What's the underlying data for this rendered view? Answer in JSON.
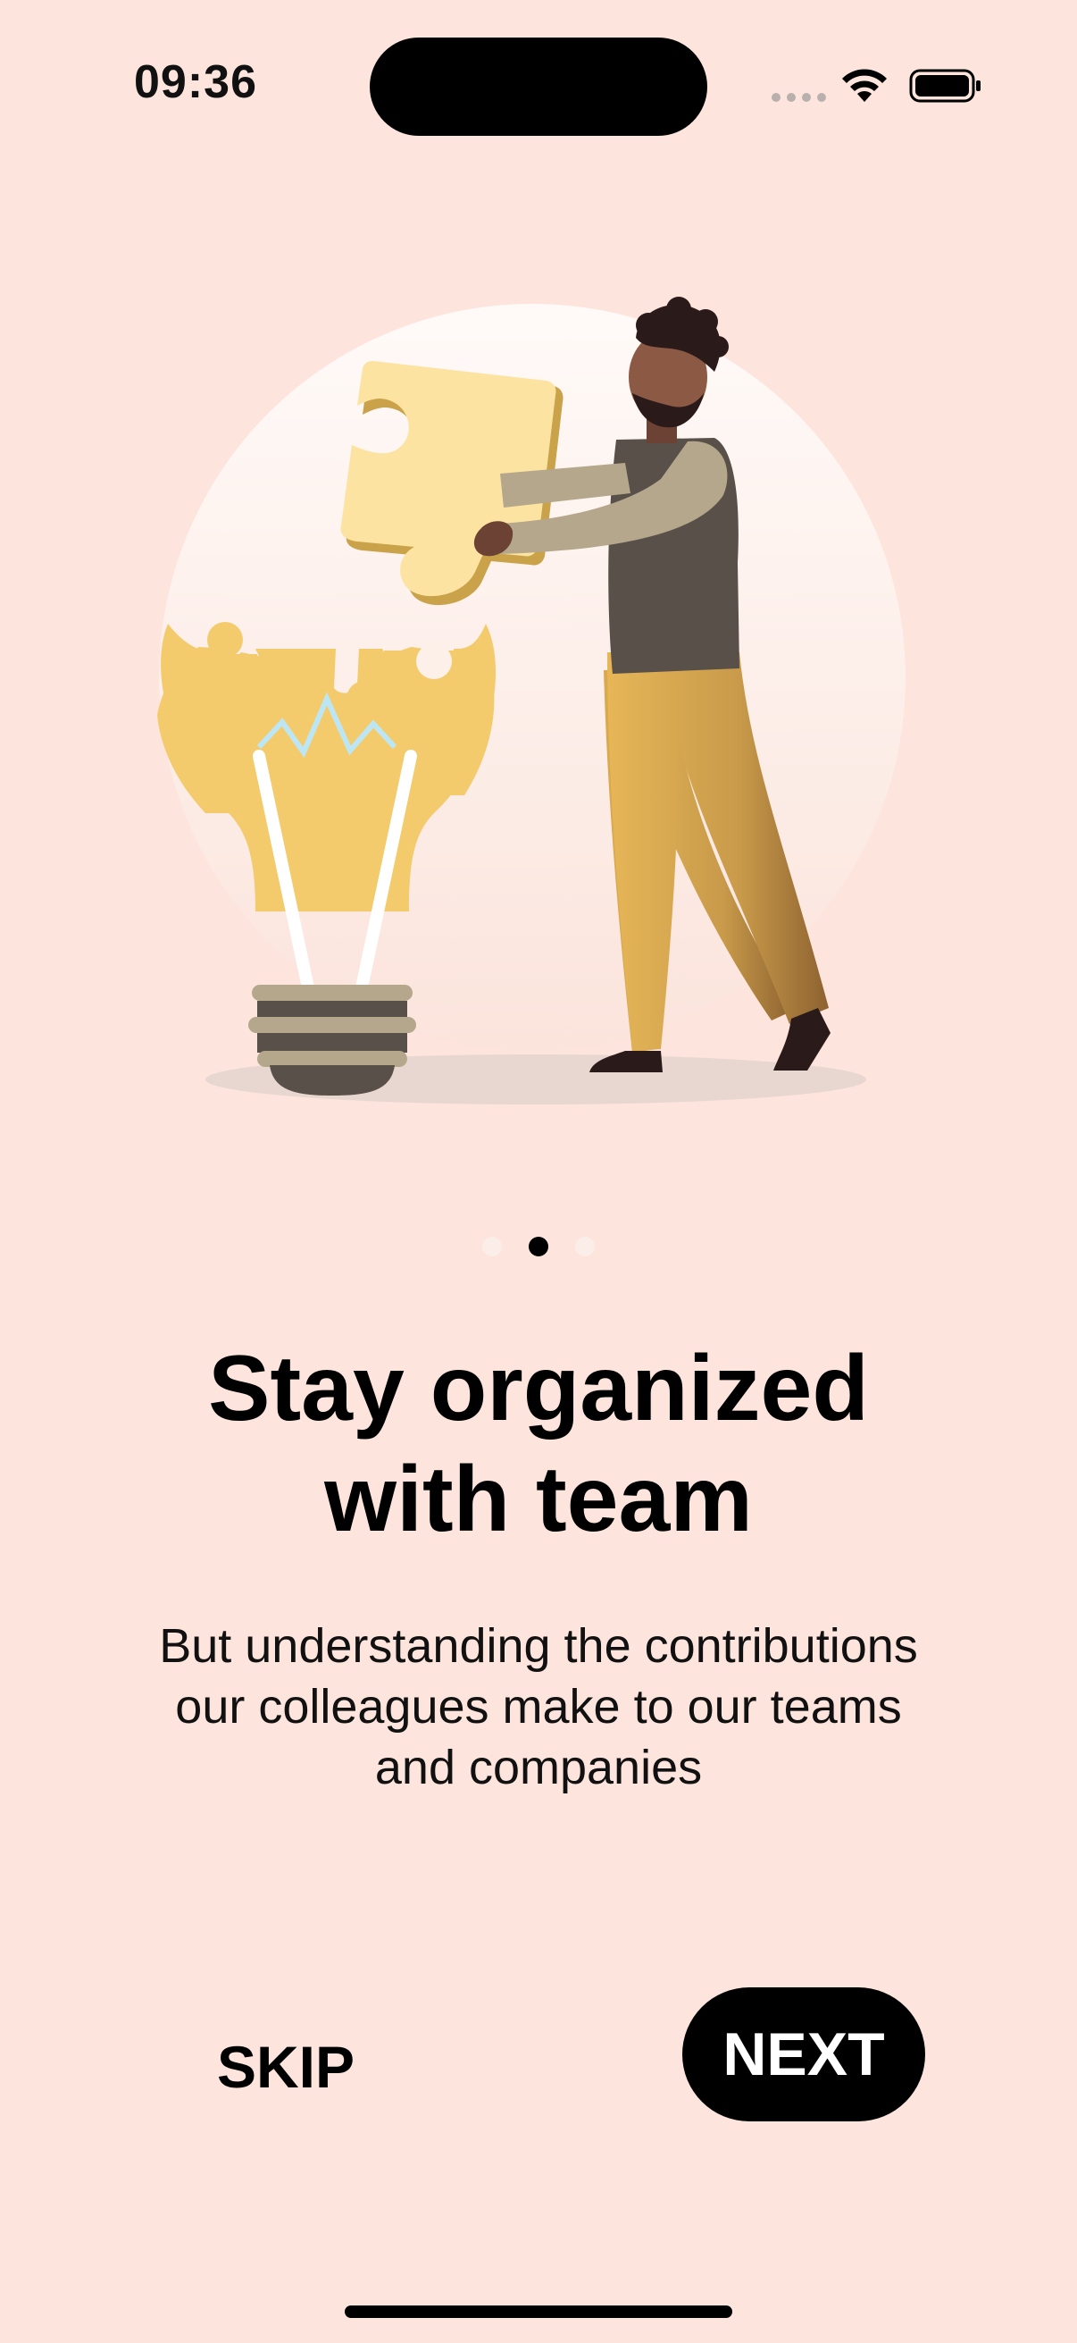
{
  "status_bar": {
    "time": "09:36",
    "icons": [
      "cellular-signal-icon",
      "wifi-icon",
      "battery-icon"
    ]
  },
  "illustration": {
    "icon": "lightbulb-puzzle-illustration"
  },
  "pagination": {
    "total": 3,
    "active_index": 1
  },
  "content": {
    "title_line1": "Stay organized",
    "title_line2": "with team",
    "description_line1": "But understanding the contributions",
    "description_line2": "our colleagues make to our teams",
    "description_line3": "and companies"
  },
  "actions": {
    "skip_label": "SKIP",
    "next_label": "NEXT"
  },
  "colors": {
    "background": "#fde4dc",
    "accent": "#000000",
    "bulb": "#f4cb6c"
  }
}
